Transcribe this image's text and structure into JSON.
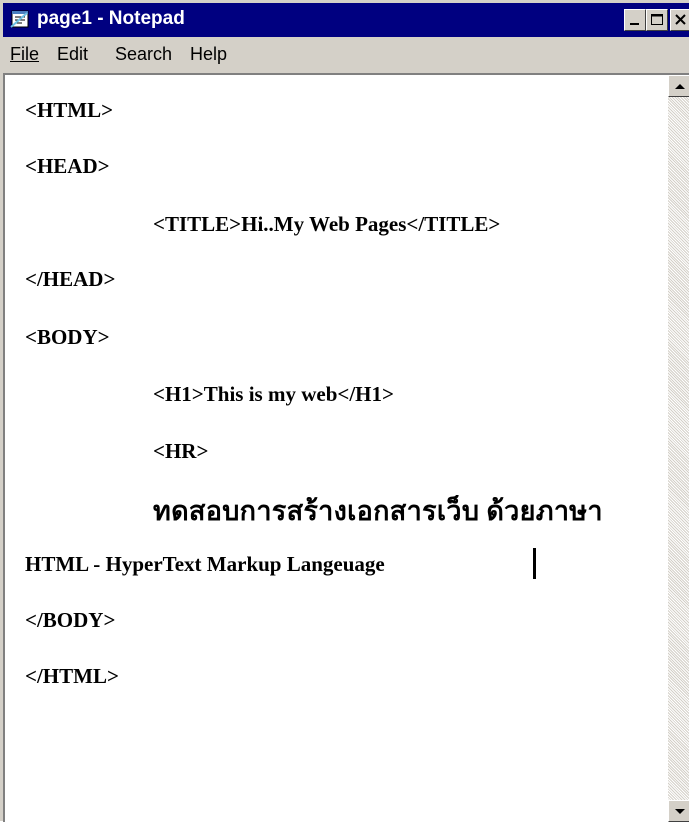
{
  "window": {
    "title": "page1 - Notepad"
  },
  "menu": {
    "file": "File",
    "edit": "Edit",
    "search": "Search",
    "help": "Help"
  },
  "editor": {
    "lines": [
      "<HTML>",
      "<HEAD>",
      "<TITLE>Hi..My Web Pages</TITLE>",
      "</HEAD>",
      "<BODY>",
      "<H1>This is my web</H1>",
      "<HR>",
      "ทดสอบการสร้างเอกสารเว็บ ด้วยภาษา",
      "HTML - HyperText Markup Langeuage",
      "</BODY>",
      "</HTML>"
    ]
  },
  "icons": {
    "app": "notepad-icon",
    "minimize": "minimize-icon",
    "maximize": "maximize-icon",
    "close": "close-icon",
    "scroll_up": "scroll-up-arrow-icon",
    "scroll_down": "scroll-down-arrow-icon"
  },
  "colors": {
    "titlebar": "#000080",
    "chrome": "#d4d0c8",
    "editor_bg": "#ffffff"
  }
}
